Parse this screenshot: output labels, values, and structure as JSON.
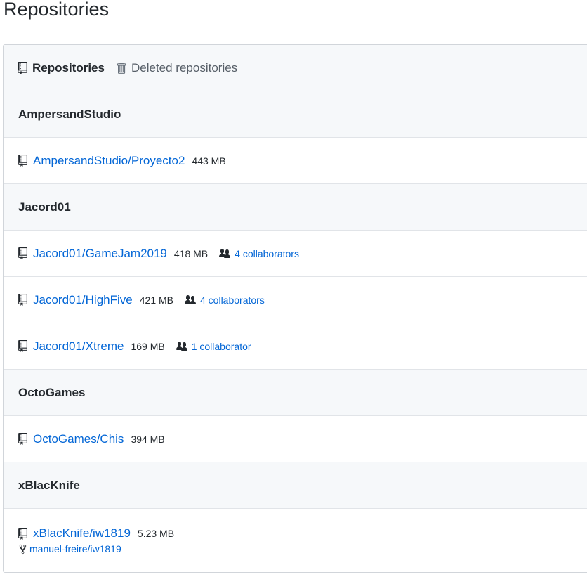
{
  "page": {
    "title": "Repositories"
  },
  "tabs": [
    {
      "label": "Repositories",
      "icon": "repo-icon",
      "selected": true
    },
    {
      "label": "Deleted repositories",
      "icon": "trash-icon",
      "selected": false
    }
  ],
  "groups": [
    {
      "owner": "AmpersandStudio",
      "repos": [
        {
          "name": "AmpersandStudio/Proyecto2",
          "size": "443 MB"
        }
      ]
    },
    {
      "owner": "Jacord01",
      "repos": [
        {
          "name": "Jacord01/GameJam2019",
          "size": "418 MB",
          "collaborators": "4 collaborators"
        },
        {
          "name": "Jacord01/HighFive",
          "size": "421 MB",
          "collaborators": "4 collaborators"
        },
        {
          "name": "Jacord01/Xtreme",
          "size": "169 MB",
          "collaborators": "1 collaborator"
        }
      ]
    },
    {
      "owner": "OctoGames",
      "repos": [
        {
          "name": "OctoGames/Chis",
          "size": "394 MB"
        }
      ]
    },
    {
      "owner": "xBlacKnife",
      "repos": [
        {
          "name": "xBlacKnife/iw1819",
          "size": "5.23 MB",
          "fork_parent": "manuel-freire/iw1819"
        }
      ]
    }
  ],
  "colors": {
    "link": "#0366d6",
    "header_bg": "#f6f8fa",
    "border": "#e1e4e8"
  }
}
